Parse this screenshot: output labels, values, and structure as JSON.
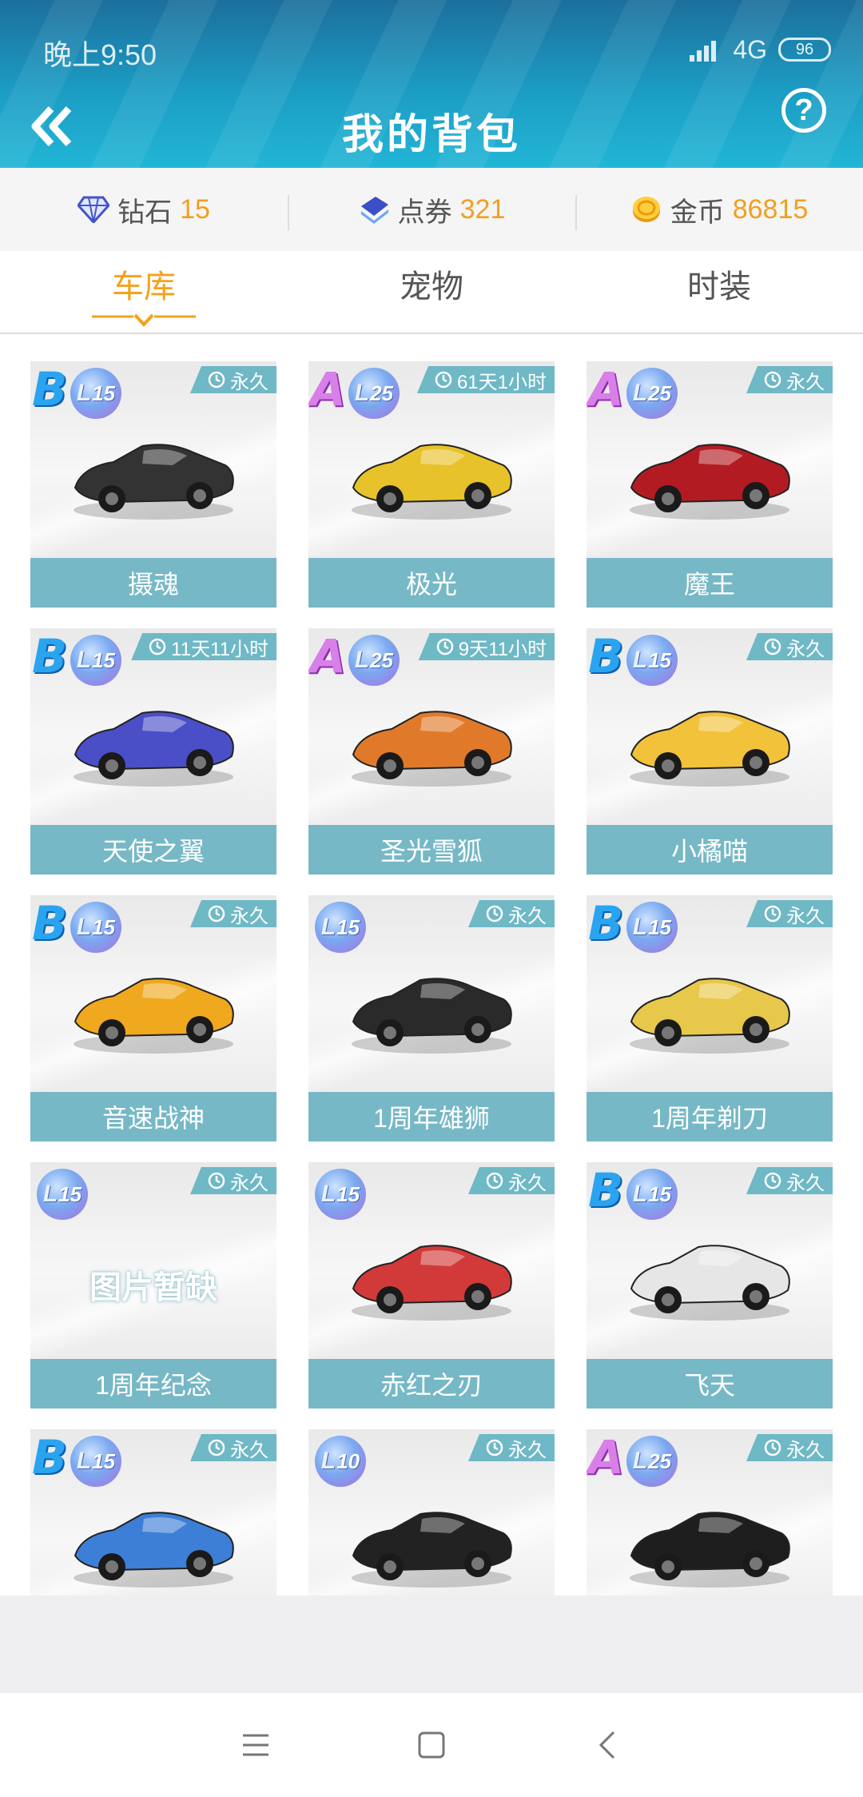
{
  "status_bar": {
    "time": "晚上9:50",
    "network": "4G",
    "battery": "96"
  },
  "header": {
    "title": "我的背包"
  },
  "currencies": [
    {
      "label": "钻石",
      "value": "15",
      "icon": "diamond-icon"
    },
    {
      "label": "点券",
      "value": "321",
      "icon": "coupon-icon"
    },
    {
      "label": "金币",
      "value": "86815",
      "icon": "gold-coin-icon"
    }
  ],
  "tabs": [
    {
      "label": "车库",
      "active": true
    },
    {
      "label": "宠物",
      "active": false
    },
    {
      "label": "时装",
      "active": false
    }
  ],
  "items": [
    {
      "name": "摄魂",
      "rank": "B",
      "level": "15",
      "time": "永久",
      "color": "#333333"
    },
    {
      "name": "极光",
      "rank": "A",
      "level": "25",
      "time": "61天1小时",
      "color": "#e8c22a"
    },
    {
      "name": "魔王",
      "rank": "A",
      "level": "25",
      "time": "永久",
      "color": "#b31b22"
    },
    {
      "name": "天使之翼",
      "rank": "B",
      "level": "15",
      "time": "11天11小时",
      "color": "#4a4fc8"
    },
    {
      "name": "圣光雪狐",
      "rank": "A",
      "level": "25",
      "time": "9天11小时",
      "color": "#e07a2a"
    },
    {
      "name": "小橘喵",
      "rank": "B",
      "level": "15",
      "time": "永久",
      "color": "#f2c23a"
    },
    {
      "name": "音速战神",
      "rank": "B",
      "level": "15",
      "time": "永久",
      "color": "#f0a81e"
    },
    {
      "name": "1周年雄狮",
      "rank": "",
      "level": "15",
      "time": "永久",
      "color": "#2a2a2a"
    },
    {
      "name": "1周年剃刀",
      "rank": "B",
      "level": "15",
      "time": "永久",
      "color": "#e8c84a"
    },
    {
      "name": "1周年纪念",
      "rank": "",
      "level": "15",
      "time": "永久",
      "placeholder": "图片暂缺"
    },
    {
      "name": "赤红之刃",
      "rank": "",
      "level": "15",
      "time": "永久",
      "color": "#d23a3a"
    },
    {
      "name": "飞天",
      "rank": "B",
      "level": "15",
      "time": "永久",
      "color": "#e6e6e6"
    },
    {
      "name": "",
      "rank": "B",
      "level": "15",
      "time": "永久",
      "color": "#3d7fd6"
    },
    {
      "name": "",
      "rank": "",
      "level": "10",
      "time": "永久",
      "color": "#222222"
    },
    {
      "name": "",
      "rank": "A",
      "level": "25",
      "time": "永久",
      "color": "#1e1e1e"
    }
  ]
}
